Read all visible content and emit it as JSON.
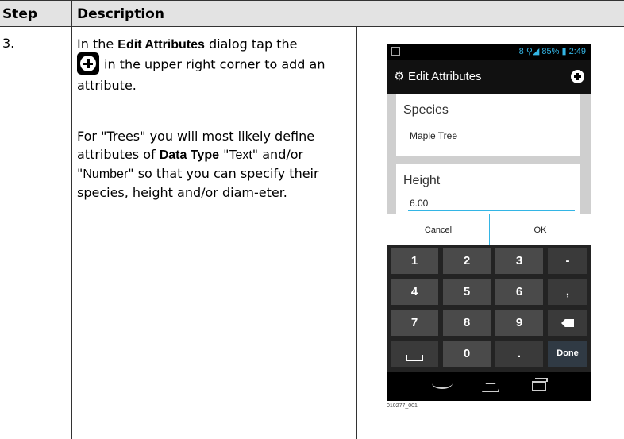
{
  "table": {
    "header_step": "Step",
    "header_description": "Description"
  },
  "row": {
    "step": "3.",
    "para1": {
      "t1": "In the ",
      "b1": "Edit Attributes",
      "t2": " dialog tap the",
      "t3": "in the upper right corner to add an attribute."
    },
    "para2": {
      "t1": "For \"Trees\" you will most likely define attributes of ",
      "b1": "Data Type",
      "t2": " \"",
      "s1": "Text",
      "t3": "\" and/or \"",
      "s2": "Number",
      "t4": "\" so that you can specify their species, height and/or diam-eter."
    }
  },
  "phone": {
    "status_right": "8 ⚲◢ 85% ▮ 2:49",
    "title": "Edit Attributes",
    "fields": [
      {
        "label": "Species",
        "value": "Maple Tree"
      },
      {
        "label": "Height",
        "value": "6.00"
      }
    ],
    "buttons": {
      "cancel": "Cancel",
      "ok": "OK"
    },
    "keys": {
      "k1": "1",
      "k2": "2",
      "k3": "3",
      "kminus": "-",
      "k4": "4",
      "k5": "5",
      "k6": "6",
      "kcomma": ",",
      "k7": "7",
      "k8": "8",
      "k9": "9",
      "k0": "0",
      "kdot": ".",
      "kdone": "Done"
    }
  },
  "caption": "010277_001",
  "icons": [
    "add-icon",
    "settings-icon",
    "back-icon",
    "home-icon",
    "recent-apps-icon",
    "backspace-icon",
    "space-icon"
  ]
}
